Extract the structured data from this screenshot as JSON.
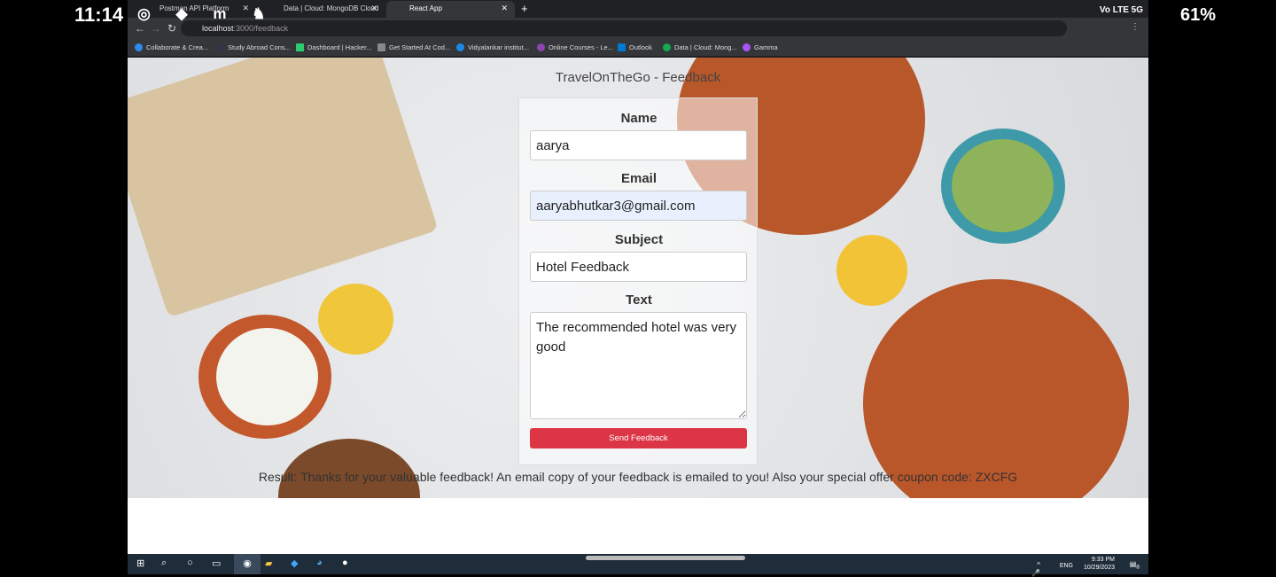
{
  "android": {
    "time": "11:14",
    "battery": "61%",
    "network": "Vo LTE 5G"
  },
  "tabs": [
    {
      "title": "Postman API Platform"
    },
    {
      "title": "Data | Cloud: MongoDB Cloud"
    },
    {
      "title": "React App"
    }
  ],
  "address": {
    "host": "localhost",
    "path": ":3000/feedback"
  },
  "bookmarks": [
    {
      "label": "Collaborate & Crea...",
      "color": "#2d8cf0"
    },
    {
      "label": "Study Abroad Cons...",
      "color": "#334"
    },
    {
      "label": "Dashboard | Hacker...",
      "color": "#2ecc71"
    },
    {
      "label": "Get Started At Cod...",
      "color": "#888"
    },
    {
      "label": "Vidyalankar institut...",
      "color": "#1e88e5"
    },
    {
      "label": "Online Courses - Le...",
      "color": "#8e44ad"
    },
    {
      "label": "Outlook",
      "color": "#0078d4"
    },
    {
      "label": "Data | Cloud: Mong...",
      "color": "#13aa52"
    },
    {
      "label": "Gamma",
      "color": "#a855f7"
    }
  ],
  "page": {
    "title": "TravelOnTheGo - Feedback",
    "form": {
      "name_label": "Name",
      "name_value": "aarya",
      "email_label": "Email",
      "email_value": "aaryabhutkar3@gmail.com",
      "subject_label": "Subject",
      "subject_value": "Hotel Feedback",
      "text_label": "Text",
      "text_value": "The recommended hotel was very good",
      "submit_label": "Send Feedback"
    },
    "result": "Result: Thanks for your valuable feedback! An email copy of your feedback is emailed to you! Also your special offer coupon code: ZXCFG"
  },
  "taskbar": {
    "language": "ENG",
    "time": "9:33 PM",
    "date": "10/29/2023",
    "notifications": "8"
  },
  "colors": {
    "button": "#dc3545",
    "autofill": "#e8f0fe"
  }
}
